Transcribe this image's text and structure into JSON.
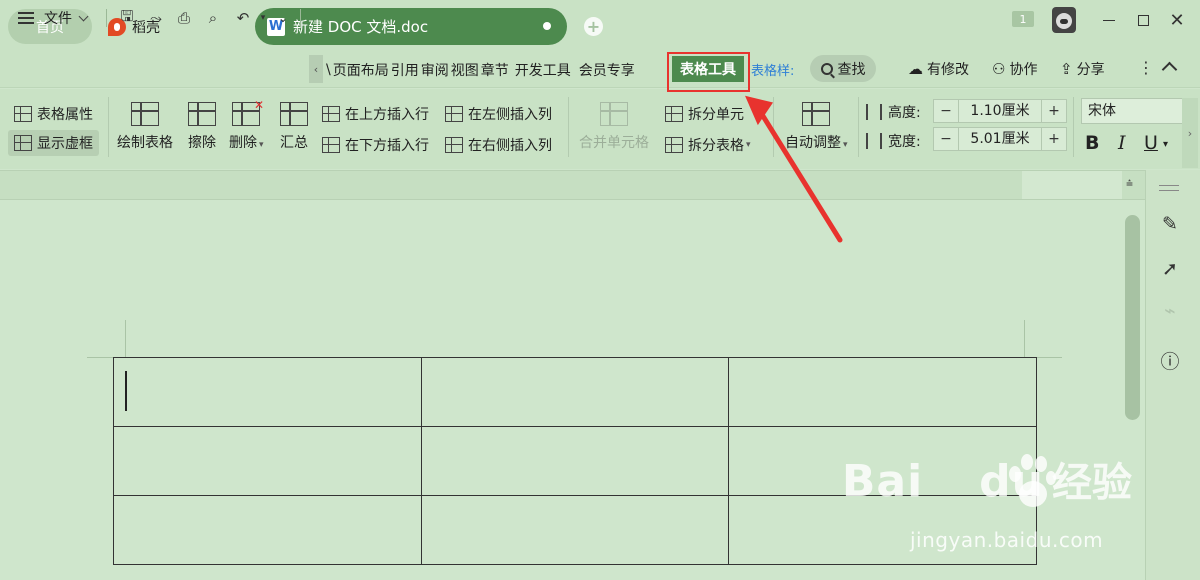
{
  "tabs": {
    "home": "首页",
    "daoke": "稻壳",
    "doc": "新建 DOC 文档.doc",
    "badge": "1"
  },
  "menu": {
    "file": "文件",
    "items": [
      "\\",
      "页面布局",
      "引用",
      "审阅",
      "视图",
      "章节",
      "开发工具",
      "会员专享"
    ],
    "table_tools": "表格工具",
    "table_style": "表格样:",
    "search": "查找",
    "modified": "有修改",
    "collab": "协作",
    "share": "分享"
  },
  "ribbon": {
    "table_props": "表格属性",
    "show_gridlines": "显示虚框",
    "draw_table": "绘制表格",
    "erase": "擦除",
    "delete": "删除",
    "summary": "汇总",
    "insert_row_above": "在上方插入行",
    "insert_row_below": "在下方插入行",
    "insert_col_left": "在左侧插入列",
    "insert_col_right": "在右侧插入列",
    "merge_cells": "合并单元格",
    "split_cells": "拆分单元",
    "split_table": "拆分表格",
    "auto_fit": "自动调整",
    "height_label": "高度:",
    "height_value": "1.10厘米",
    "width_label": "宽度:",
    "width_value": "5.01厘米",
    "font": "宋体",
    "bold": "B",
    "italic": "I",
    "underline": "U"
  },
  "table": {
    "rows": 3,
    "cols": 3
  },
  "watermark": {
    "brand": "Bai",
    "brand2": "du",
    "cn": "经验",
    "url": "jingyan.baidu.com"
  },
  "colors": {
    "accent": "#4d8a4e",
    "background": "#cfe6cc",
    "highlight": "#e8332e",
    "link": "#2e7fd6"
  }
}
